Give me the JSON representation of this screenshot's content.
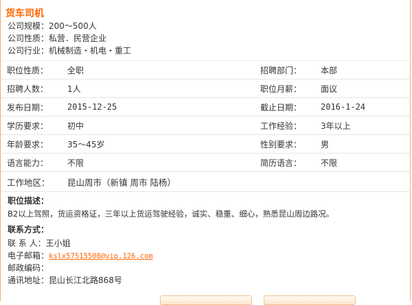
{
  "job_title": "货车司机",
  "company": {
    "scale": "公司规模：200～500人",
    "nature": "公司性质：私营．民营企业",
    "industry": "公司行业：机械制造・机电・重工"
  },
  "details": {
    "rows": [
      {
        "l1": "职位性质：",
        "v1": "全职",
        "l2": "招聘部门：",
        "v2": "本部"
      },
      {
        "l1": "招聘人数：",
        "v1": "1人",
        "l2": "职位月薪：",
        "v2": "面议"
      },
      {
        "l1": "发布日期：",
        "v1": "2015-12-25",
        "l2": "截止日期：",
        "v2": "2016-1-24"
      },
      {
        "l1": "学历要求：",
        "v1": "初中",
        "l2": "工作经验：",
        "v2": "3年以上"
      },
      {
        "l1": "年龄要求：",
        "v1": "35～45岁",
        "l2": "性别要求：",
        "v2": "男"
      },
      {
        "l1": "语言能力：",
        "v1": "不限",
        "l2": "简历语言：",
        "v2": "不限"
      }
    ],
    "area_label": "工作地区：",
    "area_value": "昆山周市（新镇 周市 陆杨）"
  },
  "description": {
    "heading": "职位描述：",
    "text": "B2以上驾照，货运资格证，三年以上货运驾驶经验，诚实、稳重、细心，熟悉昆山周边路况。"
  },
  "contact": {
    "heading": "联系方式：",
    "person": "联 系 人：王小姐",
    "email_label": "电子邮箱：",
    "email": "kslx57515508@vip.126.com",
    "postcode": "邮政编码：",
    "address": "通讯地址：昆山长江北路868号"
  },
  "colors": {
    "accent": "#ff6600",
    "border": "#e8b26a"
  }
}
